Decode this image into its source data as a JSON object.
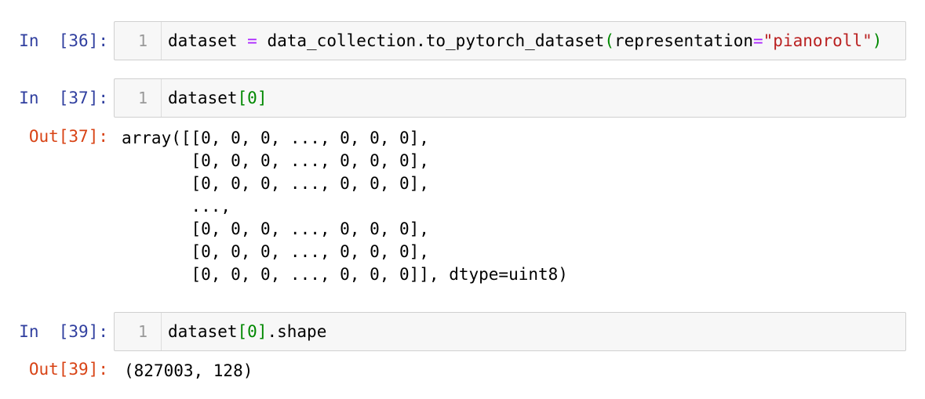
{
  "cells": [
    {
      "prompt": "In  [36]:",
      "line_number": "1",
      "code": {
        "a": "dataset ",
        "op": "=",
        "b": " data_collection.to_pytorch_dataset",
        "open": "(",
        "c": "representation",
        "eq": "=",
        "str": "\"pianoroll\"",
        "close": ")"
      }
    },
    {
      "prompt": "In  [37]:",
      "line_number": "1",
      "code": {
        "a": "dataset",
        "open": "[",
        "num": "0",
        "close": "]"
      },
      "out_prompt": "Out[37]:",
      "output": "array([[0, 0, 0, ..., 0, 0, 0],\n       [0, 0, 0, ..., 0, 0, 0],\n       [0, 0, 0, ..., 0, 0, 0],\n       ...,\n       [0, 0, 0, ..., 0, 0, 0],\n       [0, 0, 0, ..., 0, 0, 0],\n       [0, 0, 0, ..., 0, 0, 0]], dtype=uint8)"
    },
    {
      "prompt": "In  [39]:",
      "line_number": "1",
      "code": {
        "a": "dataset",
        "open": "[",
        "num": "0",
        "close": "]",
        "b": ".shape"
      },
      "out_prompt": "Out[39]:",
      "output": "(827003, 128)"
    }
  ]
}
